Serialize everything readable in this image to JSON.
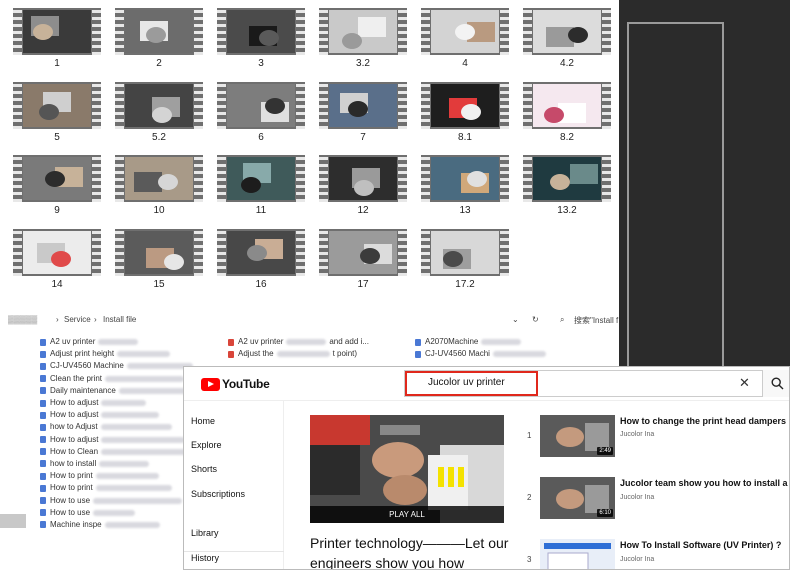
{
  "thumbnails": [
    {
      "label": "1"
    },
    {
      "label": "2"
    },
    {
      "label": "3"
    },
    {
      "label": "3.2"
    },
    {
      "label": "4"
    },
    {
      "label": "4.2"
    },
    {
      "label": "5"
    },
    {
      "label": "5.2"
    },
    {
      "label": "6"
    },
    {
      "label": "7"
    },
    {
      "label": "8.1"
    },
    {
      "label": "8.2"
    },
    {
      "label": "9"
    },
    {
      "label": "10"
    },
    {
      "label": "11"
    },
    {
      "label": "12"
    },
    {
      "label": "13"
    },
    {
      "label": "13.2"
    },
    {
      "label": "14"
    },
    {
      "label": "15"
    },
    {
      "label": "16"
    },
    {
      "label": "17"
    },
    {
      "label": "17.2"
    }
  ],
  "explorer": {
    "crumb_service": "Service",
    "crumb_install": "Install file",
    "search_hint": "搜索\"Install f"
  },
  "explorer_col1": [
    "A2 uv printer",
    "Adjust print height",
    "CJ-UV4560 Machine",
    "Clean the print",
    "Daily maintenance",
    "How to adjust",
    "How to adjust",
    "how to Adjust",
    "How to adjust",
    "How to Clean",
    "how to install",
    "How to print",
    "How to print",
    "How to use",
    "How to use",
    "Machine inspe"
  ],
  "explorer_col2": [
    "A2 uv printer",
    "Adjust the"
  ],
  "explorer_col2_tail": [
    "and add i...",
    "t point)"
  ],
  "explorer_col3": [
    "A2070Machine",
    "CJ-UV4560 Machi"
  ],
  "youtube": {
    "logo": "YouTube",
    "search_query": "Jucolor uv printer",
    "clear_symbol": "✕",
    "sidebar": [
      "Home",
      "Explore",
      "Shorts",
      "Subscriptions",
      "Library",
      "History"
    ],
    "feature_overlay": "PLAY ALL",
    "feature_title": "Printer technology———Let our engineers show you how",
    "recommendations": [
      {
        "num": "1",
        "title": "How to change the print head dampers",
        "channel": "Jucolor Ina",
        "duration": "2:49"
      },
      {
        "num": "2",
        "title": "Jucolor team show you how to install a",
        "channel": "Jucolor Ina",
        "duration": "6:10"
      },
      {
        "num": "3",
        "title": "How To Install Software (UV Printer) ?",
        "channel": "Jucolor Ina",
        "duration": ""
      }
    ]
  },
  "colors": {
    "accent_red": "#e0281c",
    "youtube_red": "#ff0000",
    "dark_bg": "#2b2b2b"
  }
}
